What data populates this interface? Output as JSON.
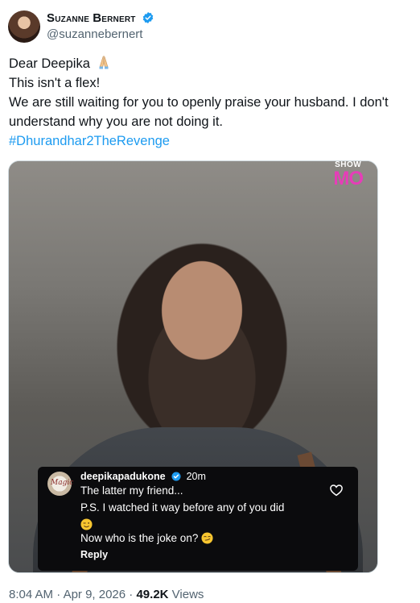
{
  "author": {
    "name_first": "S",
    "name_rest1": "uzanne ",
    "name_b": "B",
    "name_rest2": "ernert",
    "handle": "@suzannebernert"
  },
  "tweet": {
    "line1": "Dear Deepika",
    "line2": "This isn't a flex!",
    "line3": "We are still waiting for you to openly praise your husband. I don't",
    "line4": "understand why you are not doing it.",
    "hashtag": "#Dhurandhar2TheRevenge"
  },
  "media": {
    "watermark_top": "SHOW",
    "watermark_main": "MO"
  },
  "comment": {
    "avatar_text": "Magic",
    "username": "deepikapadukone",
    "time": "20m",
    "line1": "The latter my friend...",
    "line2": "P.S. I watched it way before any of you did",
    "line4": "Now who is the joke on?",
    "reply_label": "Reply"
  },
  "meta": {
    "time": "8:04 AM",
    "sep1": " · ",
    "date": "Apr 9, 2026",
    "sep2": " · ",
    "views_count": "49.2K",
    "views_label": " Views"
  },
  "colors": {
    "link": "#1d9bf0",
    "verified": "#1d9bf0",
    "watermark": "#e63db8"
  },
  "icons": [
    "verified-badge-icon",
    "folded-hands-icon",
    "heart-icon",
    "winking-face-icon",
    "smirking-face-icon"
  ]
}
